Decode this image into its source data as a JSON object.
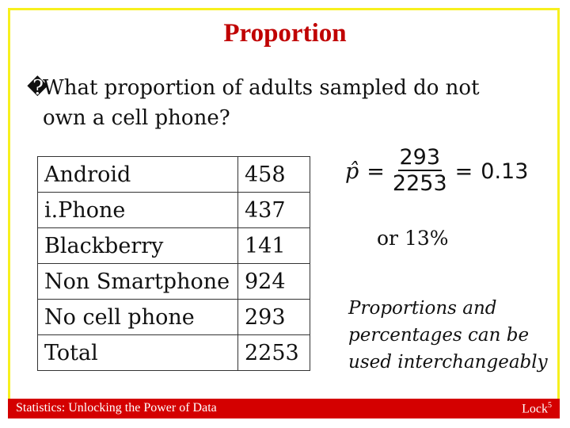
{
  "title": "Proportion",
  "question": {
    "bullet": "�",
    "line1": "What proportion of adults sampled do not",
    "line2": "own a cell phone?"
  },
  "table": {
    "rows": [
      {
        "label": "Android",
        "value": "458"
      },
      {
        "label": "i.Phone",
        "value": "437"
      },
      {
        "label": "Blackberry",
        "value": "141"
      },
      {
        "label": "Non Smartphone",
        "value": "924"
      },
      {
        "label": "No cell phone",
        "value": "293"
      },
      {
        "label": "Total",
        "value": "2253"
      }
    ]
  },
  "formula": {
    "lhs": "p̂",
    "eq": "=",
    "numerator": "293",
    "denominator": "2253",
    "result": "0.13"
  },
  "percent_text": "or 13%",
  "note": "Proportions and percentages can be used interchangeably",
  "footer": {
    "left": "Statistics: Unlocking the Power of Data",
    "right": "Lock",
    "right_sup": "5"
  },
  "colors": {
    "title": "#c00000",
    "frame": "#f7f01e",
    "footer_bg": "#d40000"
  }
}
